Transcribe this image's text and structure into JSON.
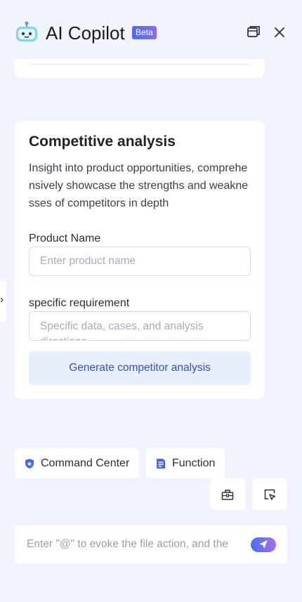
{
  "header": {
    "title": "AI Copilot",
    "badge": "Beta",
    "icons": {
      "logo": "robot-logo-icon",
      "window": "window-icon",
      "close": "close-icon"
    }
  },
  "side_tab": {
    "glyph": "›",
    "icon": "chevron-right-icon"
  },
  "card": {
    "title": "Competitive analysis",
    "description": "Insight into product opportunities, comprehensively showcase the strengths and weaknesses of competitors in depth",
    "product_name": {
      "label": "Product Name",
      "value": "",
      "placeholder": "Enter product name"
    },
    "requirement": {
      "label": "specific requirement",
      "value": "",
      "placeholder": "Specific data, cases, and analysis directions"
    },
    "submit_label": "Generate competitor analysis"
  },
  "shortcuts": [
    {
      "label": "Command Center",
      "icon": "shield-icon"
    },
    {
      "label": "Function",
      "icon": "document-icon"
    }
  ],
  "tools": [
    {
      "icon": "toolbox-icon"
    },
    {
      "icon": "select-pointer-icon"
    }
  ],
  "composer": {
    "value": "",
    "placeholder": "Enter \"@\" to evoke the file action, and the",
    "send_icon": "send-icon"
  },
  "colors": {
    "background": "#f1f4fc",
    "accent": "#2f55c9",
    "button_bg": "#e8eefc",
    "badge_start": "#4c6bff",
    "badge_end": "#8a6cf5"
  }
}
